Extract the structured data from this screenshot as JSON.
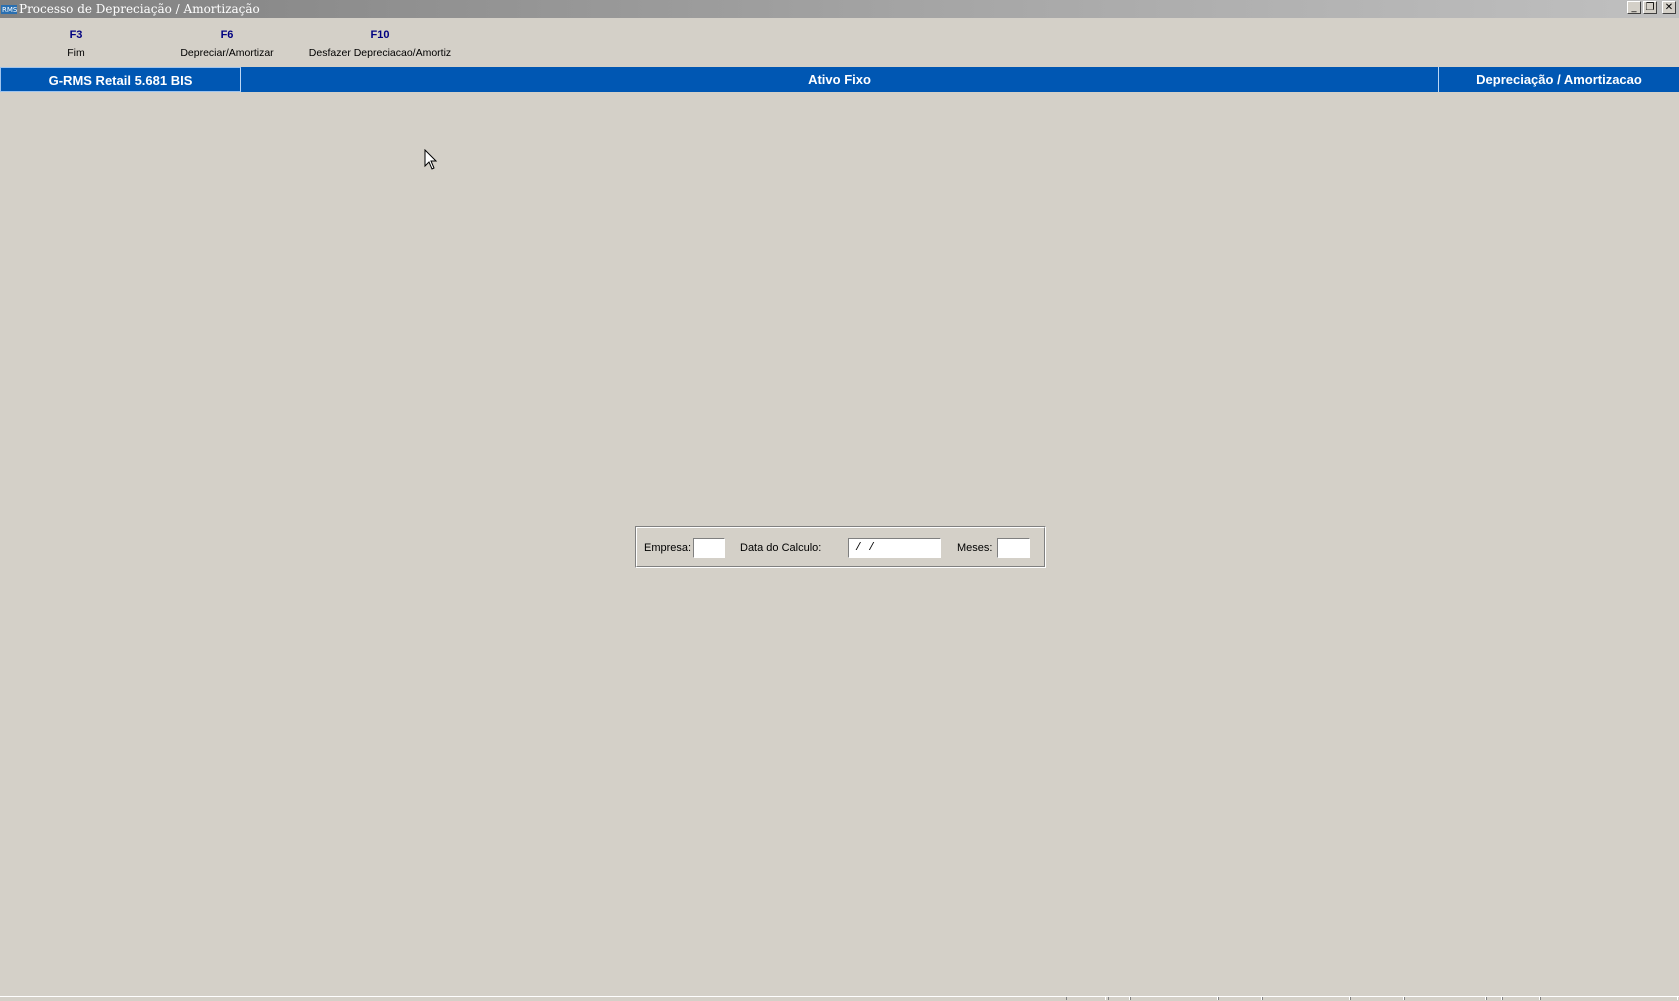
{
  "window": {
    "title": "Processo de Depreciação / Amortização",
    "icon": "rms-app-icon",
    "controls": {
      "minimize": "_",
      "restore": "❐",
      "close": "✕"
    }
  },
  "toolbar": {
    "items": [
      {
        "key": "F3",
        "label": "Fim"
      },
      {
        "key": "F6",
        "label": "Depreciar/Amortizar"
      },
      {
        "key": "F10",
        "label": "Desfazer Depreciacao/Amortiz"
      }
    ]
  },
  "header": {
    "app": "G-RMS Retail 5.681 BIS",
    "module": "Ativo Fixo",
    "screen": "Depreciação / Amortizacao",
    "color": "#0057b3"
  },
  "form": {
    "empresa_label": "Empresa:",
    "empresa_value": "",
    "data_label": "Data do Calculo:",
    "data_value": "/ /",
    "meses_label": "Meses:",
    "meses_value": ""
  },
  "colors": {
    "background": "#d4d0c8",
    "accent": "#0057b3",
    "key_text": "#000080"
  }
}
